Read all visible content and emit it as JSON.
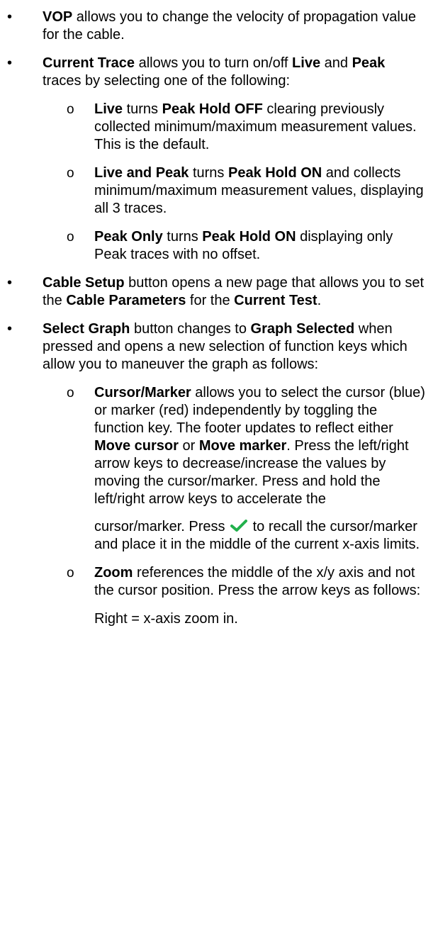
{
  "bullets": {
    "l1": "•",
    "l2": "o"
  },
  "colors": {
    "check": "#22b14c"
  },
  "item_vop": {
    "t1": "VOP",
    "t2": " allows you to change the velocity of propagation value for the cable."
  },
  "item_trace": {
    "t1": "Current Trace",
    "t2": " allows you to turn on/off ",
    "t3": "Live",
    "t4": " and ",
    "t5": "Peak",
    "t6": " traces by selecting one of the following:"
  },
  "sub_live": {
    "t1": "Live",
    "t2": " turns ",
    "t3": "Peak Hold OFF",
    "t4": " clearing previously collected minimum/maximum measurement values. This is the default."
  },
  "sub_livepeak": {
    "t1": "Live and Peak",
    "t2": " turns ",
    "t3": "Peak Hold ON",
    "t4": " and collects minimum/maximum measurement values, displaying all 3 traces."
  },
  "sub_peakonly": {
    "t1": "Peak Only",
    "t2": " turns ",
    "t3": "Peak Hold ON",
    "t4": " displaying only Peak traces with no offset."
  },
  "item_cable": {
    "t1": "Cable Setup",
    "t2": " button opens a new page that allows you to set the ",
    "t3": "Cable Parameters",
    "t4": " for the ",
    "t5": "Current Test",
    "t6": "."
  },
  "item_graph": {
    "t1": "Select Graph",
    "t2": " button changes to ",
    "t3": "Graph Selected",
    "t4": " when pressed and opens a new selection of function keys which allow you to maneuver the graph as follows:"
  },
  "sub_cursor": {
    "t1": "Cursor/Marker",
    "t2": " allows you to select the cursor (blue) or marker (red) independently by toggling the function key. The footer updates to reflect either ",
    "t3": "Move cursor",
    "t4": " or ",
    "t5": "Move marker",
    "t6": ". Press the left/right arrow keys to decrease/increase the values by moving the cursor/marker. Press and hold the left/right arrow keys to accelerate the",
    "t7": "cursor/marker. Press ",
    "check_icon": "checkmark",
    "t8": " to recall the cursor/marker and place it in the middle of the current x-axis limits."
  },
  "sub_zoom": {
    "t1": "Zoom",
    "t2": " references the middle of the x/y axis and not the cursor position. Press the arrow keys as follows:"
  },
  "zoom_right": "Right = x-axis zoom in."
}
